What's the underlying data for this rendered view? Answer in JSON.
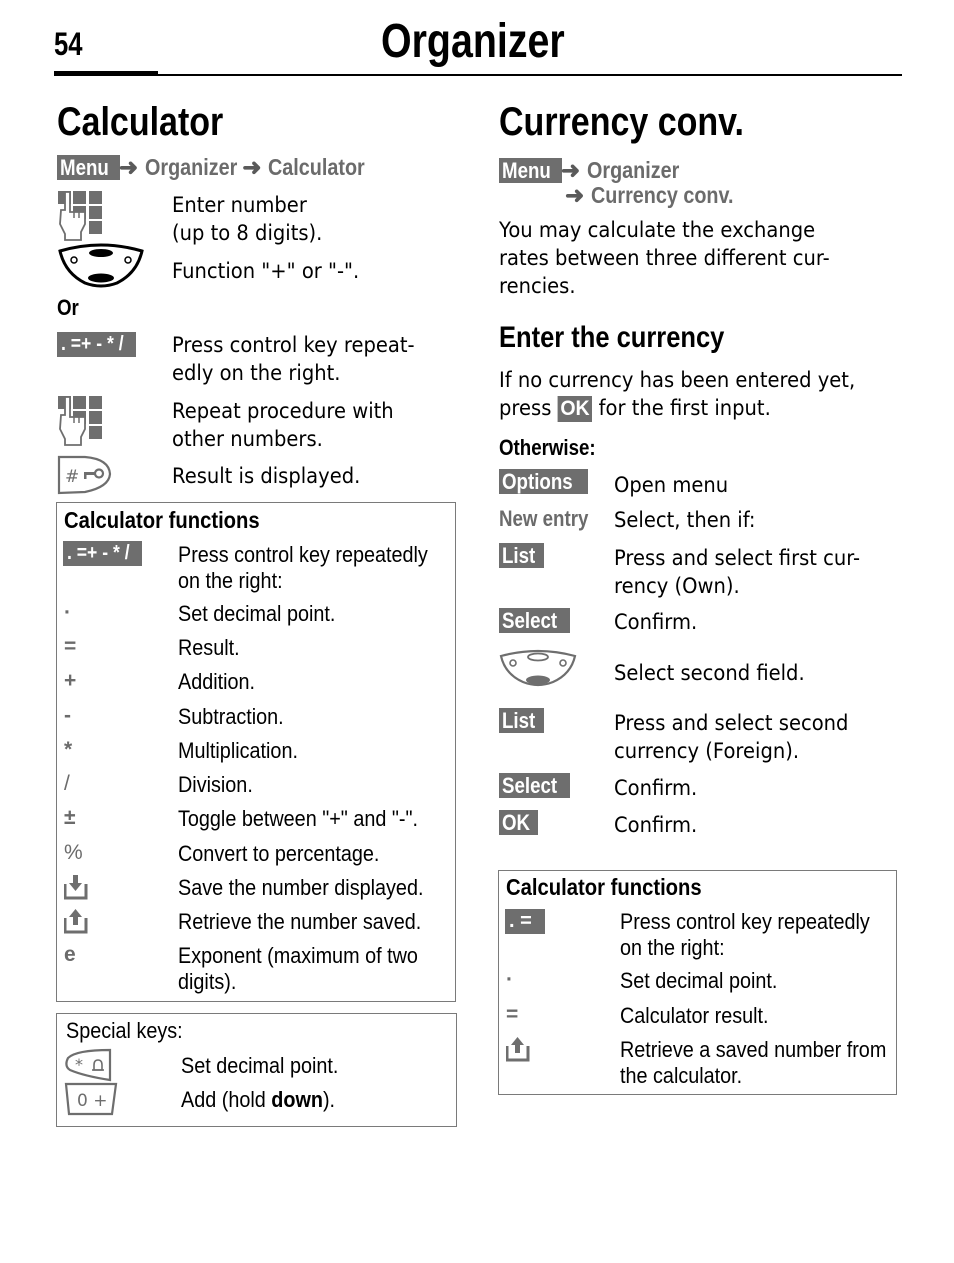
{
  "header": {
    "page_number": "54",
    "title": "Organizer"
  },
  "calculator": {
    "title": "Calculator",
    "path": {
      "menu_key": "Menu",
      "arrow": "➜",
      "steps": [
        "Organizer",
        "Calculator"
      ]
    },
    "steps": [
      {
        "icon": "keypad-hand-icon",
        "text_lines": [
          "Enter number",
          "(up to 8 digits)."
        ]
      },
      {
        "icon": "navigation-key-icon",
        "text_lines": [
          "Function \"+\" or \"-\"."
        ]
      }
    ],
    "or_label": "Or",
    "steps_alt": [
      {
        "key": ". =+ - * /",
        "text_lines": [
          "Press control key repeat-",
          "edly on the right."
        ]
      },
      {
        "icon": "keypad-hand-icon",
        "text_lines": [
          "Repeat procedure with",
          "other numbers."
        ]
      },
      {
        "icon": "hash-key-icon",
        "text_lines": [
          "Result is displayed."
        ]
      }
    ],
    "functions_box": {
      "title": "Calculator functions",
      "control_key": ". =+ - * /",
      "control_desc_lines": [
        "Press control key repeatedly",
        "on the right:"
      ],
      "rows": [
        {
          "key": "·",
          "desc_lines": [
            "Set decimal point."
          ]
        },
        {
          "key": "=",
          "desc_lines": [
            "Result."
          ]
        },
        {
          "key": "+",
          "desc_lines": [
            "Addition."
          ]
        },
        {
          "key": "-",
          "desc_lines": [
            "Subtraction."
          ]
        },
        {
          "key": "*",
          "desc_lines": [
            "Multiplication."
          ]
        },
        {
          "key": "/",
          "desc_lines": [
            "Division."
          ]
        },
        {
          "key": "±",
          "desc_lines": [
            "Toggle between \"+\" and \"-\"."
          ]
        },
        {
          "key": "%",
          "desc_lines": [
            "Convert to percentage."
          ]
        },
        {
          "key": "save-icon",
          "desc_lines": [
            "Save the number displayed."
          ]
        },
        {
          "key": "retrieve-icon",
          "desc_lines": [
            "Retrieve the number saved."
          ]
        },
        {
          "key": "e",
          "desc_lines": [
            "Exponent (maximum of two",
            "digits)."
          ]
        }
      ]
    },
    "special_keys_box": {
      "title": "Special keys:",
      "rows": [
        {
          "key_label": "* ♫",
          "desc": "Set decimal point."
        },
        {
          "key_label": "0 +",
          "desc_prefix": "Add (hold ",
          "desc_bold": "down",
          "desc_suffix": ")."
        }
      ]
    }
  },
  "currency": {
    "title": "Currency conv.",
    "path": {
      "menu_key": "Menu",
      "arrow": "➜",
      "steps": [
        "Organizer",
        "Currency conv."
      ]
    },
    "intro_lines": [
      "You may calculate the exchange",
      "rates between three different cur-",
      "rencies."
    ],
    "subheading": "Enter the currency",
    "enter_lines": {
      "line1": "If no currency has been entered yet,",
      "line2_prefix": "press ",
      "line2_key": "OK",
      "line2_suffix": " for the first input."
    },
    "otherwise_label": "Otherwise:",
    "steps": [
      {
        "key": "Options",
        "style": "softkey",
        "text_lines": [
          "Open menu"
        ]
      },
      {
        "key": "New entry",
        "style": "menu-item",
        "text_lines": [
          "Select, then if:"
        ]
      },
      {
        "key": "List",
        "style": "softkey",
        "text_lines": [
          "Press and select first cur-",
          "rency (Own)."
        ]
      },
      {
        "key": "Select",
        "style": "softkey",
        "text_lines": [
          "Confirm."
        ]
      },
      {
        "icon": "navigation-key-down-icon",
        "text_lines": [
          "Select second field."
        ]
      },
      {
        "key": "List",
        "style": "softkey",
        "text_lines": [
          "Press and select second",
          "currency (Foreign)."
        ]
      },
      {
        "key": "Select",
        "style": "softkey",
        "text_lines": [
          "Confirm."
        ]
      },
      {
        "key": "OK",
        "style": "softkey",
        "text_lines": [
          "Confirm."
        ]
      }
    ],
    "functions_box": {
      "title": "Calculator functions",
      "control_key": ". =",
      "control_desc_lines": [
        "Press control key repeatedly",
        "on the right:"
      ],
      "rows": [
        {
          "key": "·",
          "desc_lines": [
            "Set decimal point."
          ]
        },
        {
          "key": "=",
          "desc_lines": [
            "Calculator result."
          ]
        },
        {
          "key": "retrieve-icon",
          "desc_lines": [
            "Retrieve a saved number from",
            "the calculator."
          ]
        }
      ]
    }
  }
}
